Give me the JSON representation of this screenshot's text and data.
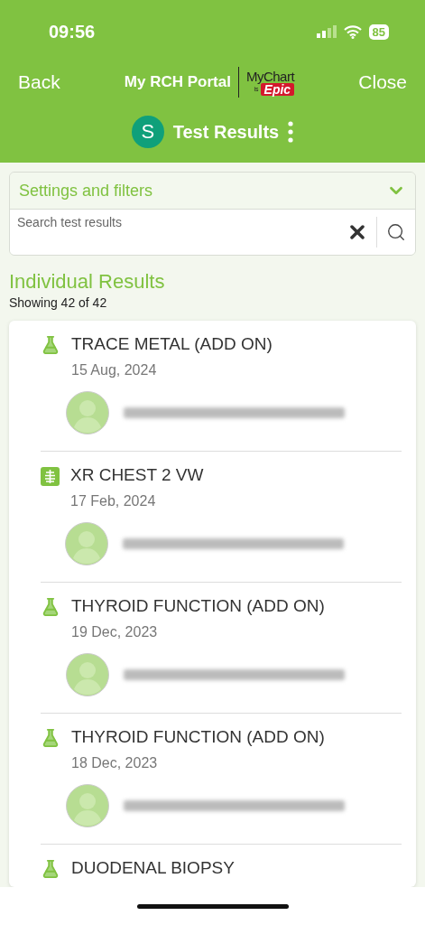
{
  "status_bar": {
    "time": "09:56",
    "battery": "85"
  },
  "header": {
    "back": "Back",
    "portal": "My RCH Portal",
    "logo_top": "MyChart",
    "logo_is": "is",
    "logo_brand": "Epic",
    "close": "Close"
  },
  "page": {
    "avatar_letter": "S",
    "title": "Test Results"
  },
  "filters": {
    "label": "Settings and filters",
    "expanded": false,
    "search_placeholder": "Search test results"
  },
  "section": {
    "title": "Individual Results",
    "count": "Showing 42 of 42"
  },
  "results": [
    {
      "kind": "lab",
      "name": "TRACE METAL (ADD ON)",
      "date": "15 Aug, 2024"
    },
    {
      "kind": "imaging",
      "name": "XR CHEST 2 VW",
      "date": "17 Feb, 2024"
    },
    {
      "kind": "lab",
      "name": "THYROID FUNCTION (ADD ON)",
      "date": "19 Dec, 2023"
    },
    {
      "kind": "lab",
      "name": "THYROID FUNCTION (ADD ON)",
      "date": "18 Dec, 2023"
    },
    {
      "kind": "lab",
      "name": "DUODENAL BIOPSY"
    }
  ]
}
